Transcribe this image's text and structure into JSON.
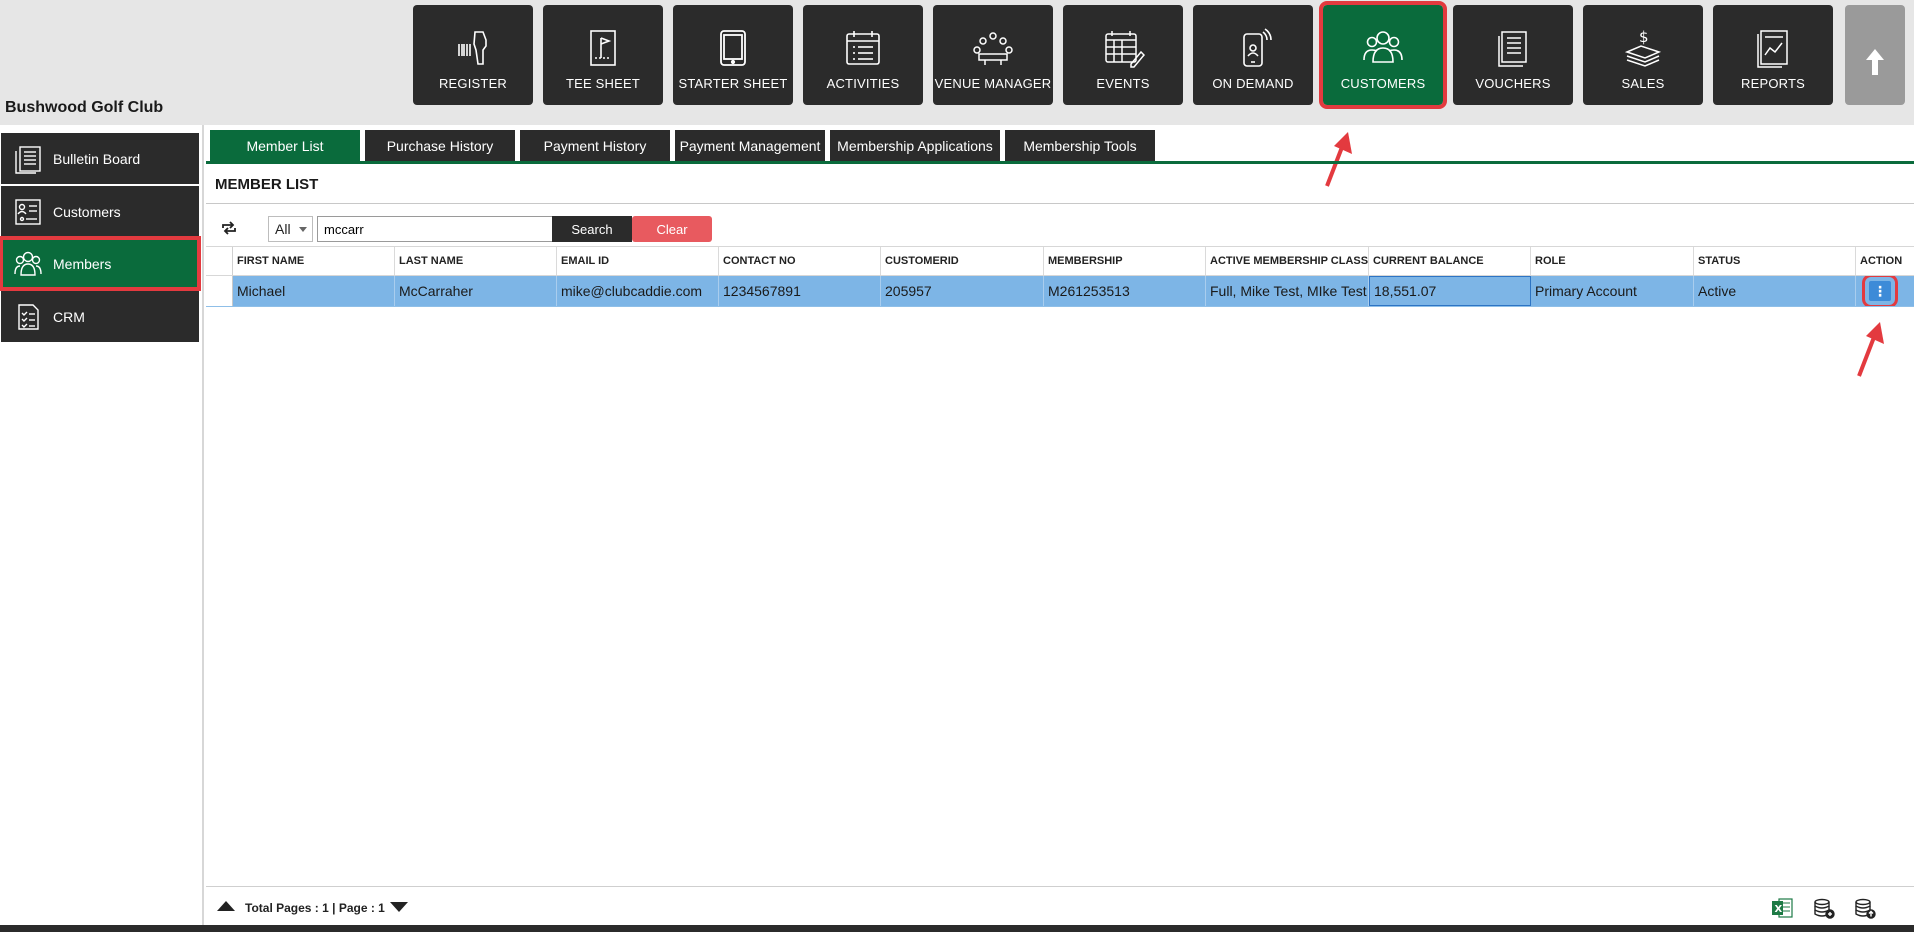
{
  "club": {
    "name": "Bushwood Golf Club"
  },
  "modules": [
    {
      "label": "REGISTER",
      "icon": "barcode-scanner-icon"
    },
    {
      "label": "TEE SHEET",
      "icon": "tee-sheet-icon"
    },
    {
      "label": "STARTER SHEET",
      "icon": "tablet-icon"
    },
    {
      "label": "ACTIVITIES",
      "icon": "calendar-list-icon"
    },
    {
      "label": "VENUE MANAGER",
      "icon": "venue-table-icon"
    },
    {
      "label": "EVENTS",
      "icon": "calendar-edit-icon"
    },
    {
      "label": "ON DEMAND",
      "icon": "mobile-phone-icon"
    },
    {
      "label": "CUSTOMERS",
      "icon": "people-group-icon",
      "active": true
    },
    {
      "label": "VOUCHERS",
      "icon": "voucher-icon"
    },
    {
      "label": "SALES",
      "icon": "money-stack-icon"
    },
    {
      "label": "REPORTS",
      "icon": "report-chart-icon"
    }
  ],
  "sidebar": {
    "items": [
      {
        "label": "Bulletin Board",
        "icon": "bulletin-board-icon"
      },
      {
        "label": "Customers",
        "icon": "customer-card-icon"
      },
      {
        "label": "Members",
        "icon": "members-group-icon",
        "active": true
      },
      {
        "label": "CRM",
        "icon": "checklist-icon"
      }
    ]
  },
  "tabs": [
    {
      "label": "Member List",
      "active": true
    },
    {
      "label": "Purchase History"
    },
    {
      "label": "Payment History"
    },
    {
      "label": "Payment Management"
    },
    {
      "label": "Membership Applications"
    },
    {
      "label": "Membership Tools"
    }
  ],
  "section": {
    "title": "MEMBER LIST"
  },
  "filter": {
    "scope": "All",
    "search_value": "mccarr",
    "search_label": "Search",
    "clear_label": "Clear"
  },
  "table": {
    "columns": [
      "FIRST NAME",
      "LAST NAME",
      "EMAIL ID",
      "CONTACT NO",
      "CUSTOMERID",
      "MEMBERSHIP",
      "ACTIVE MEMBERSHIP CLASSE",
      "CURRENT BALANCE",
      "ROLE",
      "STATUS",
      "ACTION"
    ],
    "rows": [
      {
        "first_name": "Michael",
        "last_name": "McCarraher",
        "email": "mike@clubcaddie.com",
        "contact": "1234567891",
        "customer_id": "205957",
        "membership": "M261253513",
        "active_class": "Full, Mike Test, MIke Test",
        "balance": "18,551.07",
        "role": "Primary Account",
        "status": "Active",
        "action_glyph": "⋮"
      }
    ]
  },
  "footer": {
    "pages_text": "Total Pages : 1 | Page : 1"
  },
  "colors": {
    "accent_green": "#0a6b3c",
    "dark_tile": "#2b2b2b",
    "highlight_red": "#e33a3f",
    "row_selected": "#7db5e6",
    "clear_button": "#e85a5f"
  }
}
